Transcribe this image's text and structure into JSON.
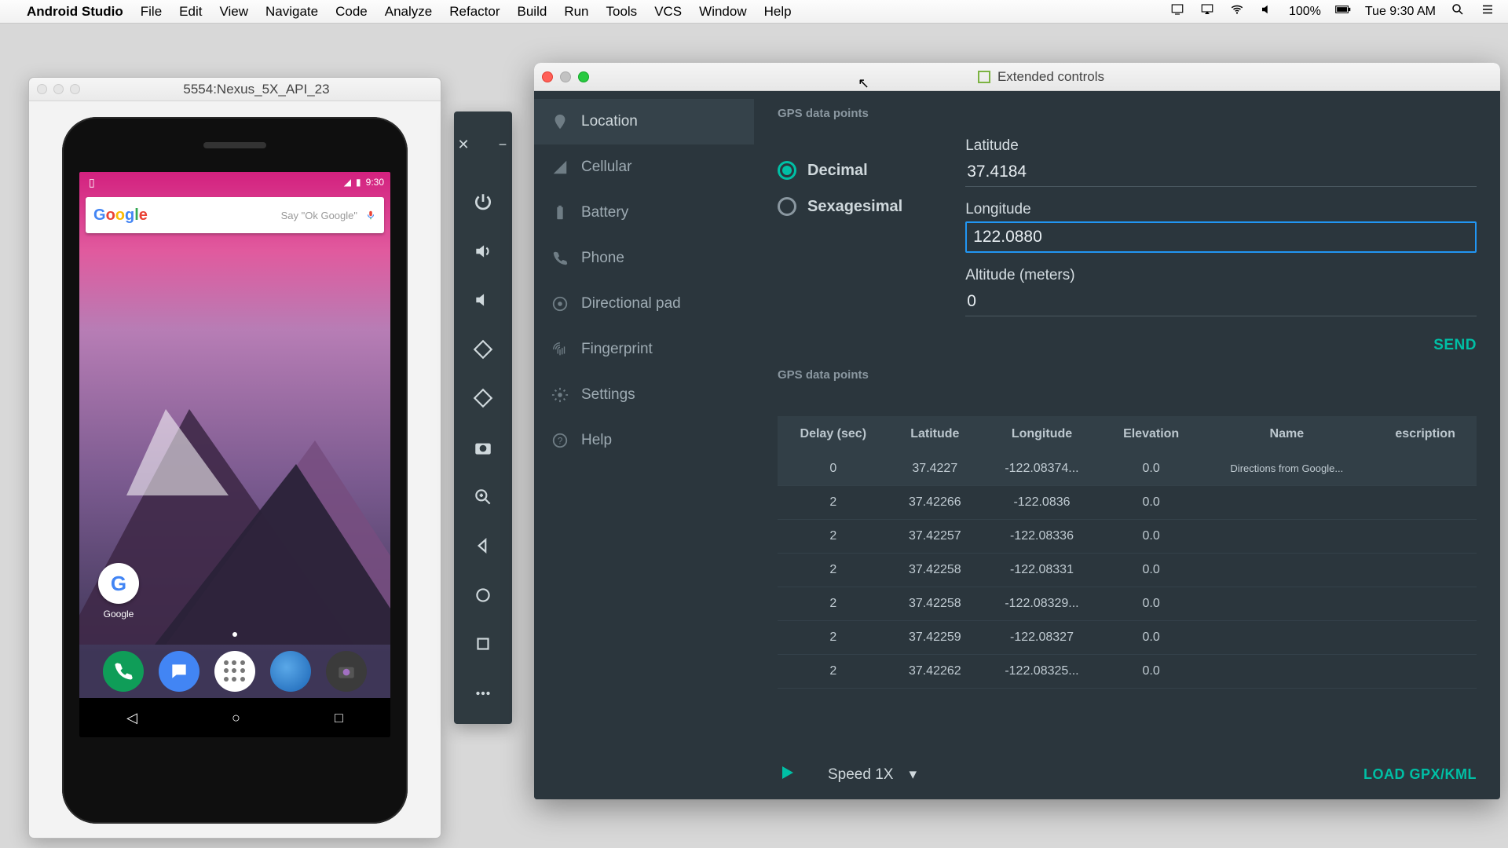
{
  "menubar": {
    "app": "Android Studio",
    "items": [
      "File",
      "Edit",
      "View",
      "Navigate",
      "Code",
      "Analyze",
      "Refactor",
      "Build",
      "Run",
      "Tools",
      "VCS",
      "Window",
      "Help"
    ],
    "battery": "100%",
    "clock": "Tue 9:30 AM"
  },
  "emulator": {
    "title": "5554:Nexus_5X_API_23",
    "status_time": "9:30",
    "search_placeholder": "Say \"Ok Google\"",
    "folder_label": "Google"
  },
  "ext": {
    "title": "Extended controls",
    "sidebar": [
      {
        "label": "Location",
        "icon": "location"
      },
      {
        "label": "Cellular",
        "icon": "cellular"
      },
      {
        "label": "Battery",
        "icon": "battery"
      },
      {
        "label": "Phone",
        "icon": "phone"
      },
      {
        "label": "Directional pad",
        "icon": "dpad"
      },
      {
        "label": "Fingerprint",
        "icon": "fingerprint"
      },
      {
        "label": "Settings",
        "icon": "settings"
      },
      {
        "label": "Help",
        "icon": "help"
      }
    ],
    "section1_title": "GPS data points",
    "radio": {
      "decimal": "Decimal",
      "sexagesimal": "Sexagesimal"
    },
    "fields": {
      "lat_label": "Latitude",
      "lat_value": "37.4184",
      "lon_label": "Longitude",
      "lon_value": "122.0880",
      "alt_label": "Altitude (meters)",
      "alt_value": "0"
    },
    "send": "SEND",
    "section2_title": "GPS data points",
    "columns": [
      "Delay (sec)",
      "Latitude",
      "Longitude",
      "Elevation",
      "Name",
      "escription"
    ],
    "rows": [
      {
        "delay": "0",
        "lat": "37.4227",
        "lon": "-122.08374...",
        "elev": "0.0",
        "name": "Directions from Google...",
        "desc": ""
      },
      {
        "delay": "2",
        "lat": "37.42266",
        "lon": "-122.0836",
        "elev": "0.0",
        "name": "",
        "desc": ""
      },
      {
        "delay": "2",
        "lat": "37.42257",
        "lon": "-122.08336",
        "elev": "0.0",
        "name": "",
        "desc": ""
      },
      {
        "delay": "2",
        "lat": "37.42258",
        "lon": "-122.08331",
        "elev": "0.0",
        "name": "",
        "desc": ""
      },
      {
        "delay": "2",
        "lat": "37.42258",
        "lon": "-122.08329...",
        "elev": "0.0",
        "name": "",
        "desc": ""
      },
      {
        "delay": "2",
        "lat": "37.42259",
        "lon": "-122.08327",
        "elev": "0.0",
        "name": "",
        "desc": ""
      },
      {
        "delay": "2",
        "lat": "37.42262",
        "lon": "-122.08325...",
        "elev": "0.0",
        "name": "",
        "desc": ""
      }
    ],
    "speed": "Speed 1X",
    "load": "LOAD GPX/KML"
  }
}
